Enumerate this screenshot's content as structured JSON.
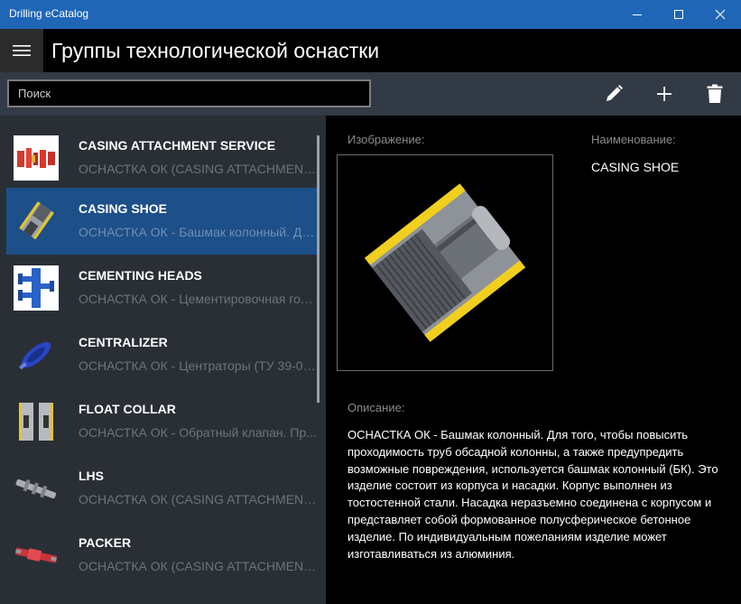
{
  "window": {
    "title": "Drilling eCatalog",
    "controls": [
      "minimize-icon",
      "maximize-icon",
      "close-icon"
    ],
    "accent": "#1f66b7"
  },
  "header": {
    "title": "Группы технологической оснастки"
  },
  "toolbar": {
    "search_placeholder": "Поиск",
    "search_value": "",
    "buttons": [
      "edit-icon",
      "add-icon",
      "delete-icon"
    ]
  },
  "list": {
    "selected_index": 1,
    "items": [
      {
        "title": "CASING ATTACHMENT SERVICE",
        "subtitle": "ОСНАСТКА ОК (CASING ATTACHMENT) - ..."
      },
      {
        "title": "CASING SHOE",
        "subtitle": "ОСНАСТКА ОК - Башмак колонный. Дл..."
      },
      {
        "title": "CEMENTING HEADS",
        "subtitle": "ОСНАСТКА ОК - Цементировочная гол..."
      },
      {
        "title": "CENTRALIZER",
        "subtitle": "ОСНАСТКА ОК - Центраторы (ТУ 39-01..."
      },
      {
        "title": "FLOAT COLLAR",
        "subtitle": "ОСНАСТКА ОК - Обратный клапан. Пр..."
      },
      {
        "title": "LHS",
        "subtitle": "ОСНАСТКА ОК (CASING ATTACHMENT)..."
      },
      {
        "title": "PACKER",
        "subtitle": "ОСНАСТКА ОК (CASING ATTACHMENT)..."
      }
    ]
  },
  "detail": {
    "image_label": "Изображение:",
    "name_label": "Наименование:",
    "name_value": "CASING SHOE",
    "description_label": "Описание:",
    "description": "ОСНАСТКА ОК - Башмак колонный. Для того, чтобы повысить проходимость труб обсадной колонны, а также предупредить возможные повреждения, используется башмак колонный (БК). Это изделие состоит из корпуса и насадки. Корпус выполнен из тостостенной стали. Насадка неразъемно соединена с корпусом и представляет собой формованное полусферическое бетонное изделие. По индивидуальным пожеланиям изделие может изготавливаться из алюминия."
  }
}
